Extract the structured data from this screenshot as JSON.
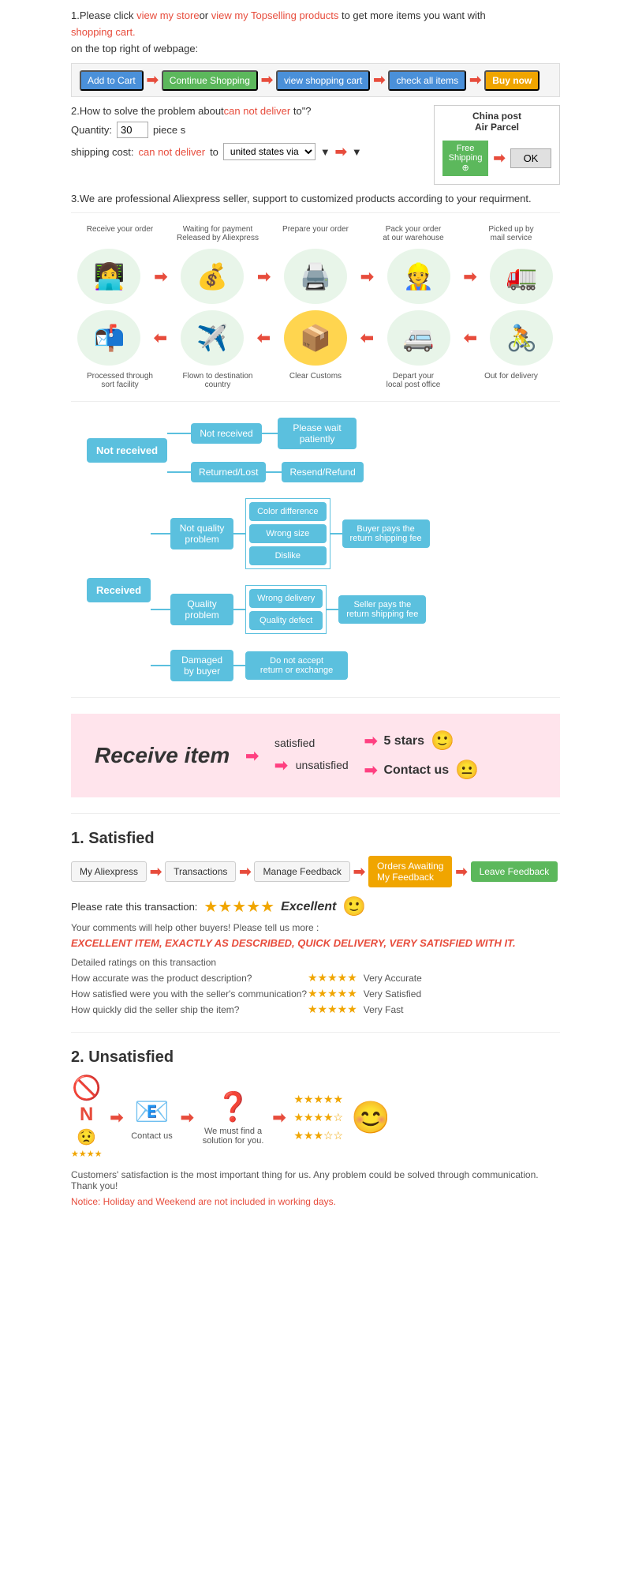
{
  "section1": {
    "text1": "1.Please click ",
    "link1": "view my store",
    "text2": "or ",
    "link2": "view my Topselling products",
    "text3": " to get more items you want with",
    "shopping_cart": "shopping cart.",
    "text4": "on the top right of webpage:",
    "btn_add": "Add to Cart",
    "btn_continue": "Continue Shopping",
    "btn_view": "view shopping cart",
    "btn_check": "check all items",
    "btn_buy": "Buy now"
  },
  "section2": {
    "title": "2.How to solve the problem about",
    "red_text": "can not deliver",
    "text2": " to\"?",
    "qty_label": "Quantity:",
    "qty_value": "30",
    "qty_unit": "piece s",
    "shipping_label": "shipping cost:",
    "shipping_red": "can not deliver",
    "shipping_text": " to ",
    "shipping_via": "united states via",
    "china_post_title": "China post",
    "china_post_sub": "Air Parcel",
    "free_shipping": "Free\nShipping",
    "ok_btn": "OK"
  },
  "section3": {
    "text": "3.We are professional Aliexpress seller, support to customized products according to your requirment."
  },
  "process": {
    "steps_top": [
      "Receive your order",
      "Waiting for payment\nReleased by Aliexpress",
      "Prepare your order",
      "Pack your order\nat our warehouse",
      "Picked up by\nmail service"
    ],
    "steps_bottom": [
      "Out for delivery",
      "Depart your\nlocal post office",
      "Clear Customs",
      "Flown to destination\ncountry",
      "Processed through\nsort facility"
    ],
    "icons_top": [
      "👩‍💻",
      "💰",
      "🖨️",
      "👷",
      "🚛"
    ],
    "icons_bottom": [
      "🚴",
      "🚐",
      "📦",
      "✈️",
      "📬"
    ]
  },
  "not_received_tree": {
    "root": "Not received",
    "branch1": "Not received",
    "branch1_result": "Please wait\npatiently",
    "branch2": "Returned/Lost",
    "branch2_result": "Resend/Refund"
  },
  "received_tree": {
    "root": "Received",
    "not_quality": "Not quality\nproblem",
    "nq_items": [
      "Color difference",
      "Wrong size",
      "Dislike"
    ],
    "nq_result": "Buyer pays the\nreturn shipping fee",
    "quality": "Quality\nproblem",
    "q_items": [
      "Wrong delivery",
      "Quality defect"
    ],
    "q_result": "Seller pays the\nreturn shipping fee",
    "damaged": "Damaged\nby buyer",
    "d_result": "Do not accept\nreturn or exchange"
  },
  "pink_section": {
    "title": "Receive item",
    "row1_text": "satisfied",
    "row1_result": "5 stars",
    "row2_text": "unsatisfied",
    "row2_result": "Contact us",
    "smiley1": "🙂",
    "smiley2": "😐"
  },
  "satisfied": {
    "title": "1. Satisfied",
    "steps": [
      "My Aliexpress",
      "Transactions",
      "Manage Feedback",
      "Orders Awaiting\nMy Feedback",
      "Leave Feedback"
    ],
    "highlight_step": 3,
    "rate_label": "Please rate this transaction:",
    "stars": "★★★★★",
    "excellent": "Excellent",
    "smiley": "🙂",
    "comment": "Your comments will help other buyers! Please tell us more :",
    "excellent_item": "EXCELLENT ITEM, EXACTLY AS DESCRIBED, QUICK DELIVERY, VERY SATISFIED WITH IT.",
    "detailed_title": "Detailed ratings on this transaction",
    "details": [
      {
        "label": "How accurate was the product description?",
        "stars": "★★★★★",
        "result": "Very Accurate"
      },
      {
        "label": "How satisfied were you with the seller's communication?",
        "stars": "★★★★★",
        "result": "Very Satisfied"
      },
      {
        "label": "How quickly did the seller ship the item?",
        "stars": "★★★★★",
        "result": "Very Fast"
      }
    ]
  },
  "unsatisfied": {
    "title": "2. Unsatisfied",
    "icons": [
      "🚫",
      "😟",
      "📧",
      "❓",
      "⭐"
    ],
    "contact_label": "Contact us",
    "find_label": "We must find\na solution for\nyou.",
    "stars_rows": [
      "★★★★★",
      "★★★★",
      "★★★"
    ],
    "smiley": "😊",
    "footer": "Customers' satisfaction is the most important thing for us. Any problem could be solved through communication. Thank you!",
    "notice": "Notice: Holiday and Weekend are not included in working days."
  }
}
